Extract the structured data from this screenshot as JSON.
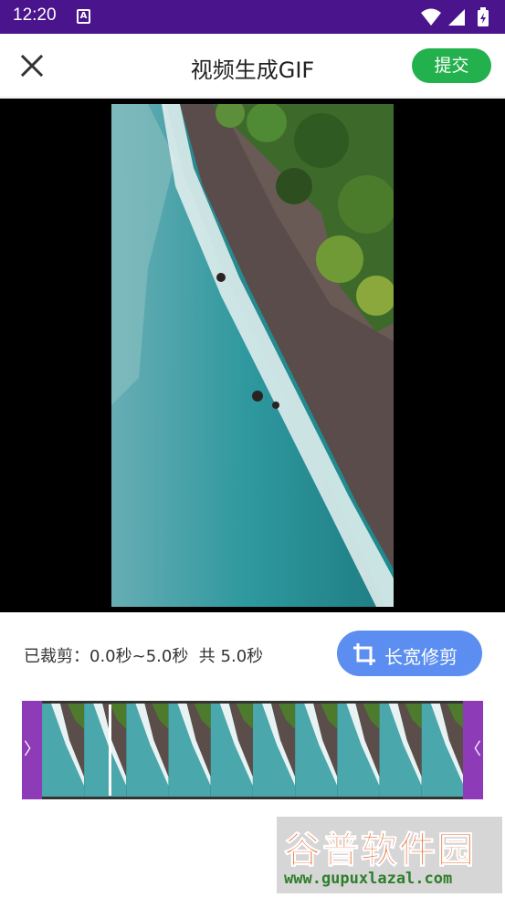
{
  "status_bar": {
    "time": "12:20",
    "notification_icon": "text-a-icon",
    "icons": [
      "wifi-icon",
      "signal-icon",
      "battery-charging-icon"
    ]
  },
  "app_bar": {
    "close_icon": "close-icon",
    "title": "视频生成GIF",
    "submit_label": "提交",
    "submit_color": "#23b14d"
  },
  "crop": {
    "info_label": "已裁剪：",
    "range": "0.0秒~5.0秒",
    "total": "共 5.0秒",
    "aspect_button_label": "长宽修剪",
    "aspect_button_icon": "crop-icon",
    "aspect_button_color": "#5b8ef0"
  },
  "timeline": {
    "left_handle": "〉",
    "right_handle": "〈",
    "handle_color": "#8e3bb8",
    "thumbnail_count": 10
  },
  "watermark": {
    "brand": "谷普软件园",
    "url": "www.gupuxlazal.com"
  }
}
